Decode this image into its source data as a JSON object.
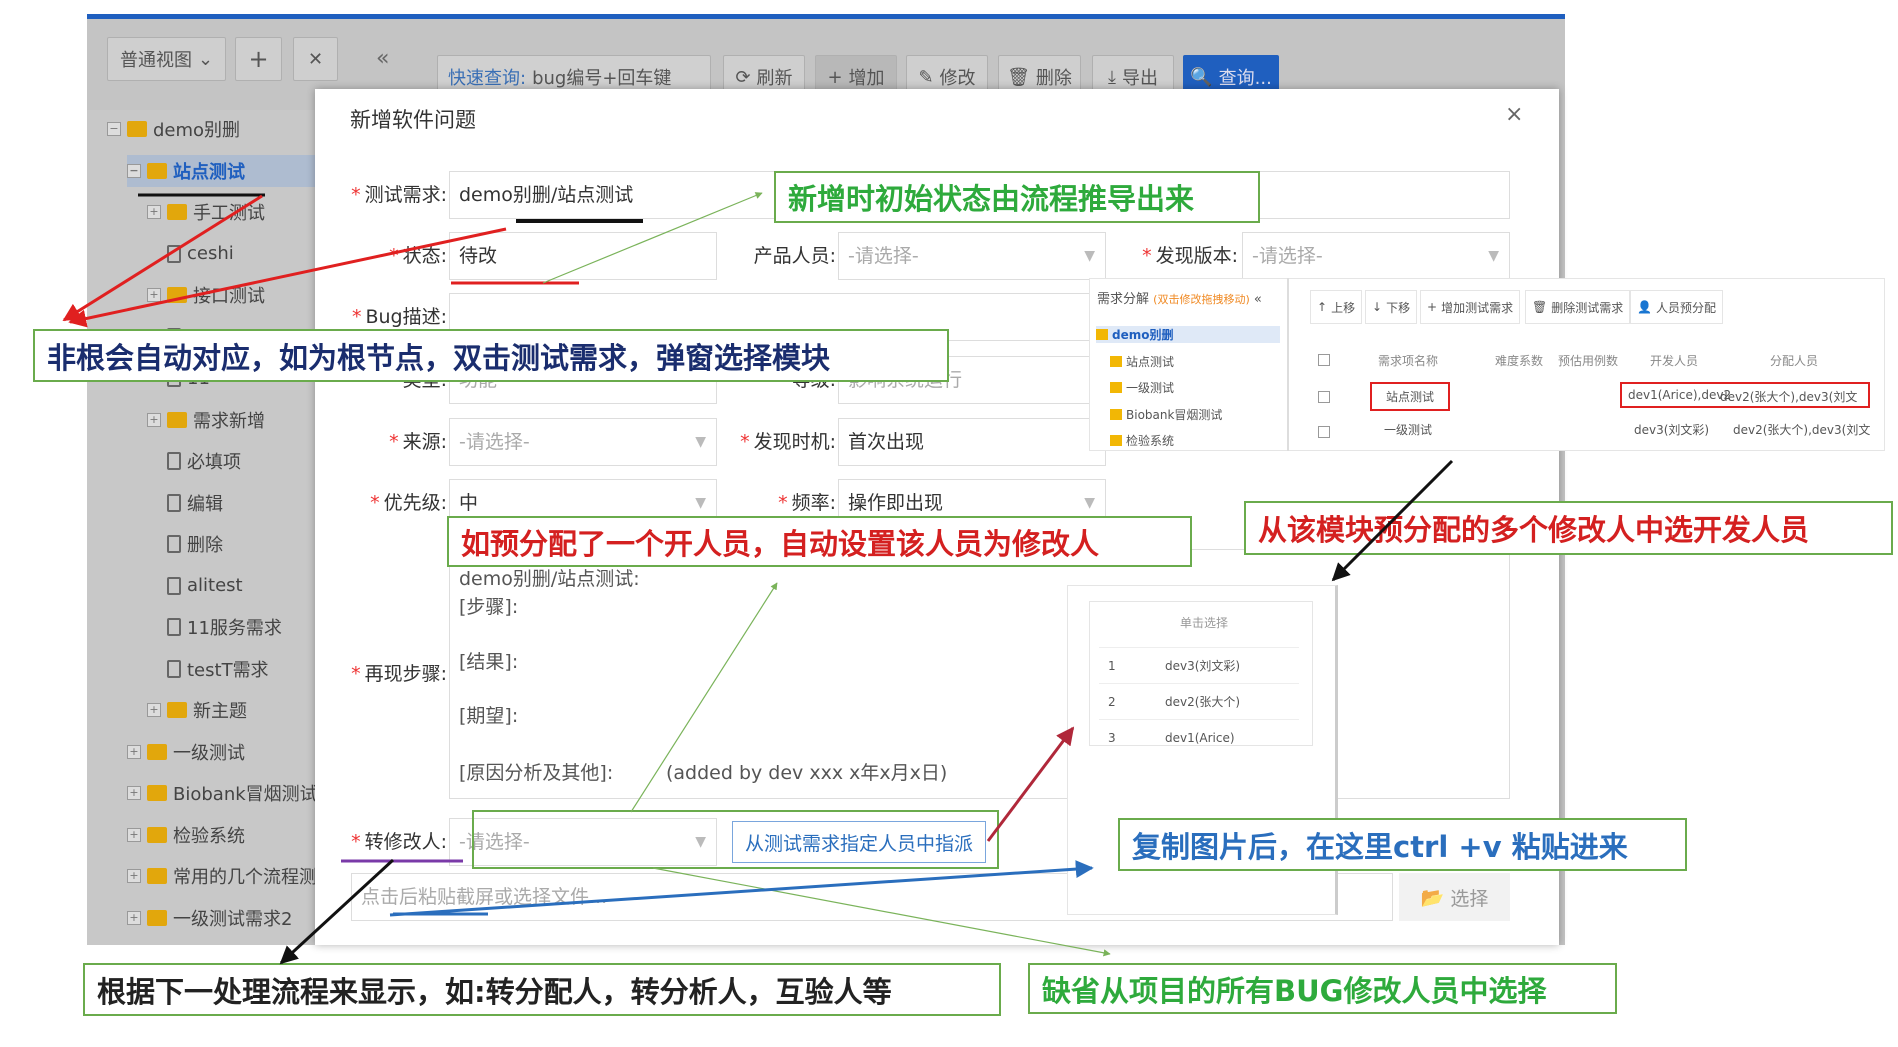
{
  "app": {
    "view_select": "普通视图",
    "add_icon": "plus-icon",
    "close_icon": "x-icon",
    "collapse": "«",
    "quick_search_label": "快速查询:",
    "quick_search_placeholder": "bug编号+回车键",
    "toolbar": {
      "refresh": "刷新",
      "add": "增加",
      "edit": "修改",
      "delete": "删除",
      "export": "导出",
      "query": "查询..."
    },
    "accent": "#1f5fbf",
    "tree": [
      {
        "label": "demo别删",
        "level": 0,
        "type": "folder",
        "expanded": true
      },
      {
        "label": "站点测试",
        "level": 1,
        "type": "folder",
        "expanded": true,
        "selected": true
      },
      {
        "label": "手工测试",
        "level": 2,
        "type": "folder"
      },
      {
        "label": "ceshi",
        "level": 2,
        "type": "doc"
      },
      {
        "label": "接口测试",
        "level": 2,
        "type": "folder"
      },
      {
        "label": "1",
        "level": 2,
        "type": "doc"
      },
      {
        "label": "11",
        "level": 2,
        "type": "doc"
      },
      {
        "label": "需求新增",
        "level": 2,
        "type": "folder"
      },
      {
        "label": "必填项",
        "level": 2,
        "type": "doc"
      },
      {
        "label": "编辑",
        "level": 2,
        "type": "doc"
      },
      {
        "label": "删除",
        "level": 2,
        "type": "doc"
      },
      {
        "label": "alitest",
        "level": 2,
        "type": "doc"
      },
      {
        "label": "11服务需求",
        "level": 2,
        "type": "doc"
      },
      {
        "label": "testT需求",
        "level": 2,
        "type": "doc"
      },
      {
        "label": "新主题",
        "level": 2,
        "type": "folder"
      },
      {
        "label": "一级测试",
        "level": 1,
        "type": "folder"
      },
      {
        "label": "Biobank冒烟测试",
        "level": 1,
        "type": "folder"
      },
      {
        "label": "检验系统",
        "level": 1,
        "type": "folder"
      },
      {
        "label": "常用的几个流程测",
        "level": 1,
        "type": "folder"
      },
      {
        "label": "一级测试需求2",
        "level": 1,
        "type": "folder"
      }
    ]
  },
  "dialog": {
    "title": "新增软件问题",
    "close": "×",
    "fields": {
      "test_req": {
        "label": "测试需求:",
        "value": "demo别删/站点测试"
      },
      "status": {
        "label": "状态:",
        "value": "待改"
      },
      "product_person": {
        "label": "产品人员:",
        "value": "-请选择-"
      },
      "found_version": {
        "label": "发现版本:",
        "value": "-请选择-"
      },
      "bug_desc": {
        "label": "Bug描述:",
        "value": ""
      },
      "type": {
        "label": "类型:",
        "value": "功能"
      },
      "level": {
        "label": "等级:",
        "value": "影响系统运行"
      },
      "source": {
        "label": "来源:",
        "value": "-请选择-"
      },
      "found_time": {
        "label": "发现时机:",
        "value": "首次出现"
      },
      "priority": {
        "label": "优先级:",
        "value": "中"
      },
      "frequency": {
        "label": "频率:",
        "value": "操作即出现"
      },
      "repro": {
        "label": "再现步骤:",
        "lines": [
          "demo别删/站点测试:",
          "[步骤]:",
          "[结果]:",
          "[期望]:",
          "[原因分析及其他]:"
        ],
        "added_by": "(added by dev xxx x年x月x日)"
      },
      "assignee": {
        "label": "转修改人:",
        "value": "-请选择-",
        "assign_button": "从测试需求指定人员中指派"
      },
      "file": {
        "placeholder": "点击后粘贴截屏或选择文件...",
        "choose_button": "选择"
      }
    }
  },
  "req_panel": {
    "title": "需求分解",
    "hint": "(双击修改拖拽移动)",
    "collapse": "«",
    "tree": [
      "demo别删",
      "站点测试",
      "一级测试",
      "Biobank冒烟测试",
      "检验系统"
    ],
    "buttons": [
      "上移",
      "下移",
      "增加测试需求",
      "删除测试需求",
      "人员预分配"
    ],
    "columns": [
      "需求项名称",
      "难度系数",
      "预估用例数",
      "开发人员",
      "分配人员"
    ],
    "rows": [
      {
        "name": "站点测试",
        "dev": "dev1(Arice),dev2",
        "assigned": "dev2(张大个),dev3(刘文"
      },
      {
        "name": "一级测试",
        "dev": "dev3(刘文彩)",
        "assigned": "dev2(张大个),dev3(刘文"
      }
    ]
  },
  "picker": {
    "header": "单击选择",
    "rows": [
      {
        "no": "1",
        "name": "dev3(刘文彩)"
      },
      {
        "no": "2",
        "name": "dev2(张大个)"
      },
      {
        "no": "3",
        "name": "dev1(Arice)"
      }
    ]
  },
  "annotations": {
    "a1": "新增时初始状态由流程推导出来",
    "a2": "非根会自动对应，如为根节点，双击测试需求，弹窗选择模块",
    "a3": "如预分配了一个开人员，自动设置该人员为修改人",
    "a4": "从该模块预分配的多个修改人中选开发人员",
    "a5": "复制图片后，在这里ctrl +v  粘贴进来",
    "a6": "根据下一处理流程来显示，如:转分配人，转分析人，互验人等",
    "a7": "缺省从项目的所有BUG修改人员中选择"
  }
}
